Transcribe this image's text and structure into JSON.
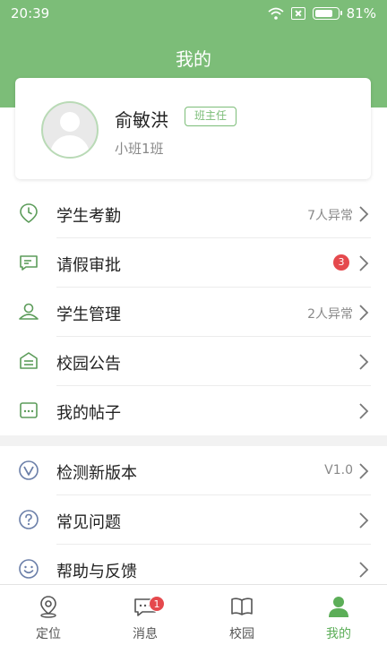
{
  "status_bar": {
    "time": "20:39",
    "battery": "81%",
    "battery_level": 0.81
  },
  "header": {
    "title": "我的"
  },
  "profile": {
    "name": "俞敏洪",
    "role": "班主任",
    "class_name": "小班1班"
  },
  "menu_group1": [
    {
      "label": "学生考勤",
      "value": "7人异常",
      "icon": "location-clock-icon"
    },
    {
      "label": "请假审批",
      "badge": "3",
      "icon": "message-icon"
    },
    {
      "label": "学生管理",
      "value": "2人异常",
      "icon": "user-icon"
    },
    {
      "label": "校园公告",
      "icon": "notice-icon"
    },
    {
      "label": "我的帖子",
      "icon": "post-icon"
    }
  ],
  "menu_group2": [
    {
      "label": "检测新版本",
      "value": "V1.0",
      "icon": "version-icon"
    },
    {
      "label": "常见问题",
      "icon": "question-icon"
    },
    {
      "label": "帮助与反馈",
      "icon": "smile-icon"
    }
  ],
  "tabs": [
    {
      "label": "定位",
      "icon": "location-pin-icon"
    },
    {
      "label": "消息",
      "icon": "chat-icon",
      "badge": "1"
    },
    {
      "label": "校园",
      "icon": "book-icon"
    },
    {
      "label": "我的",
      "icon": "person-icon",
      "active": true
    }
  ],
  "colors": {
    "brand": "#7cbd78",
    "icon": "#5c9c5a",
    "badge": "#e5494d"
  }
}
